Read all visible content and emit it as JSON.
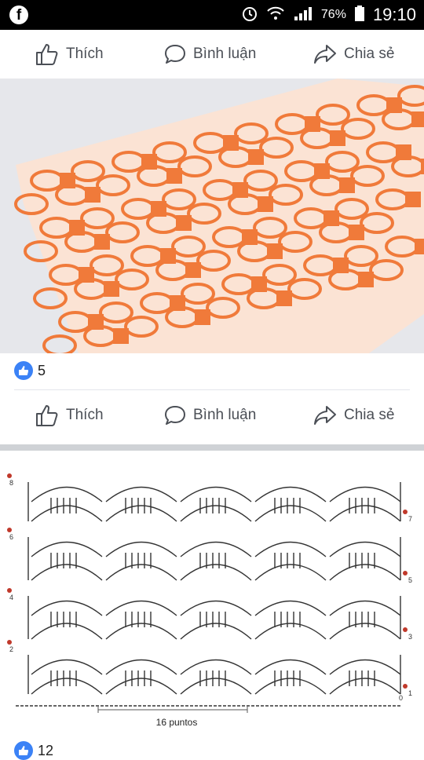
{
  "statusbar": {
    "app_icon": "facebook-icon",
    "battery_percent": "76%",
    "time": "19:10"
  },
  "post1": {
    "actions": {
      "like_label": "Thích",
      "comment_label": "Bình luận",
      "share_label": "Chia sẻ"
    },
    "like_count": "5"
  },
  "post2": {
    "actions": {
      "like_label": "Thích",
      "comment_label": "Bình luận",
      "share_label": "Chia sẻ"
    },
    "like_count": "12"
  },
  "diagram": {
    "caption": "16 puntos",
    "row_numbers": [
      "8",
      "7",
      "6",
      "5",
      "4",
      "3",
      "2",
      "1"
    ],
    "base_label": "0"
  },
  "colors": {
    "yarn": "#f07a3a",
    "like_blue": "#3b82f6",
    "action_text": "#4b4f56",
    "marker_red": "#c0392b"
  }
}
